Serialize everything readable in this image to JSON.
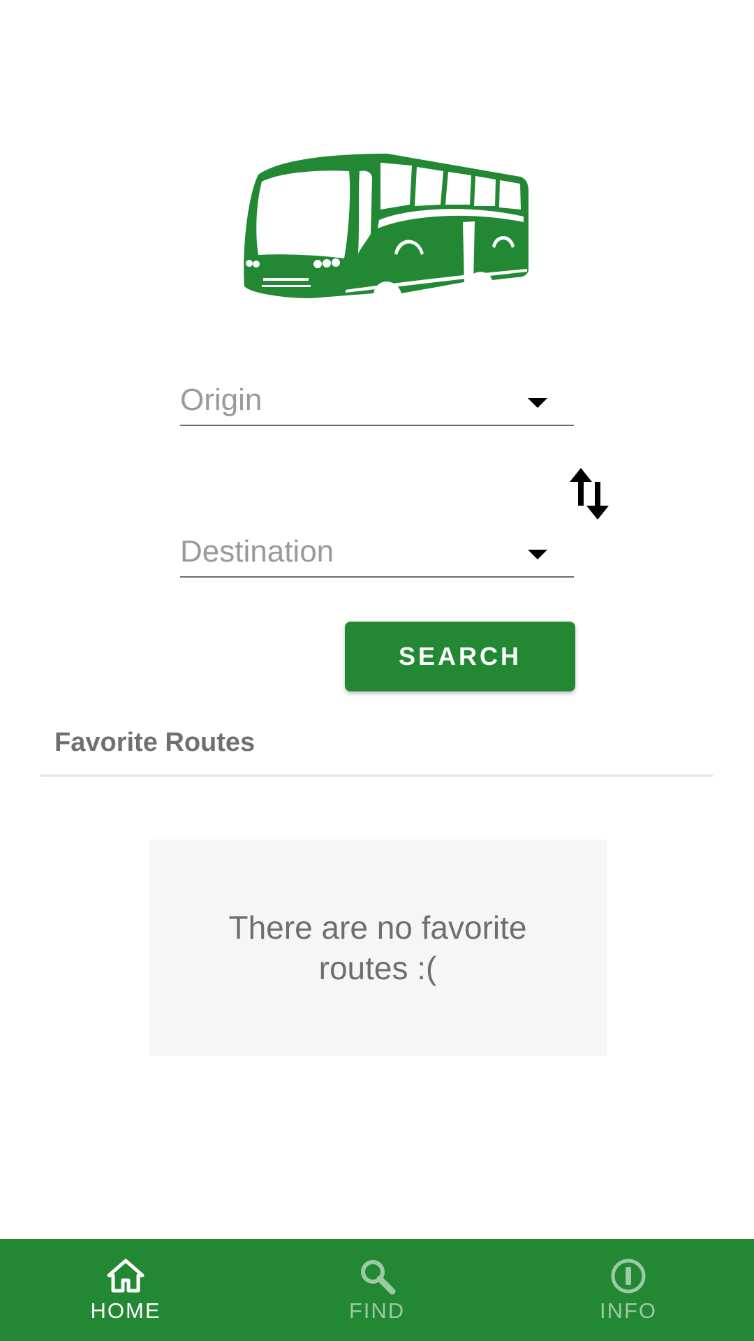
{
  "logo": {
    "icon": "bus-icon",
    "color": "#228833"
  },
  "form": {
    "origin_placeholder": "Origin",
    "destination_placeholder": "Destination",
    "swap_icon": "swap-vertical-icon",
    "search_label": "SEARCH"
  },
  "favorites": {
    "title": "Favorite Routes",
    "empty_message": "There are no favorite routes :("
  },
  "bottom_nav": {
    "items": [
      {
        "label": "HOME",
        "icon": "home-icon",
        "active": true
      },
      {
        "label": "FIND",
        "icon": "search-icon",
        "active": false
      },
      {
        "label": "INFO",
        "icon": "info-icon",
        "active": false
      }
    ]
  },
  "colors": {
    "primary": "#228833",
    "nav_inactive": "#9ccaa5",
    "text_secondary": "#707070",
    "placeholder": "#9a9a9a"
  }
}
